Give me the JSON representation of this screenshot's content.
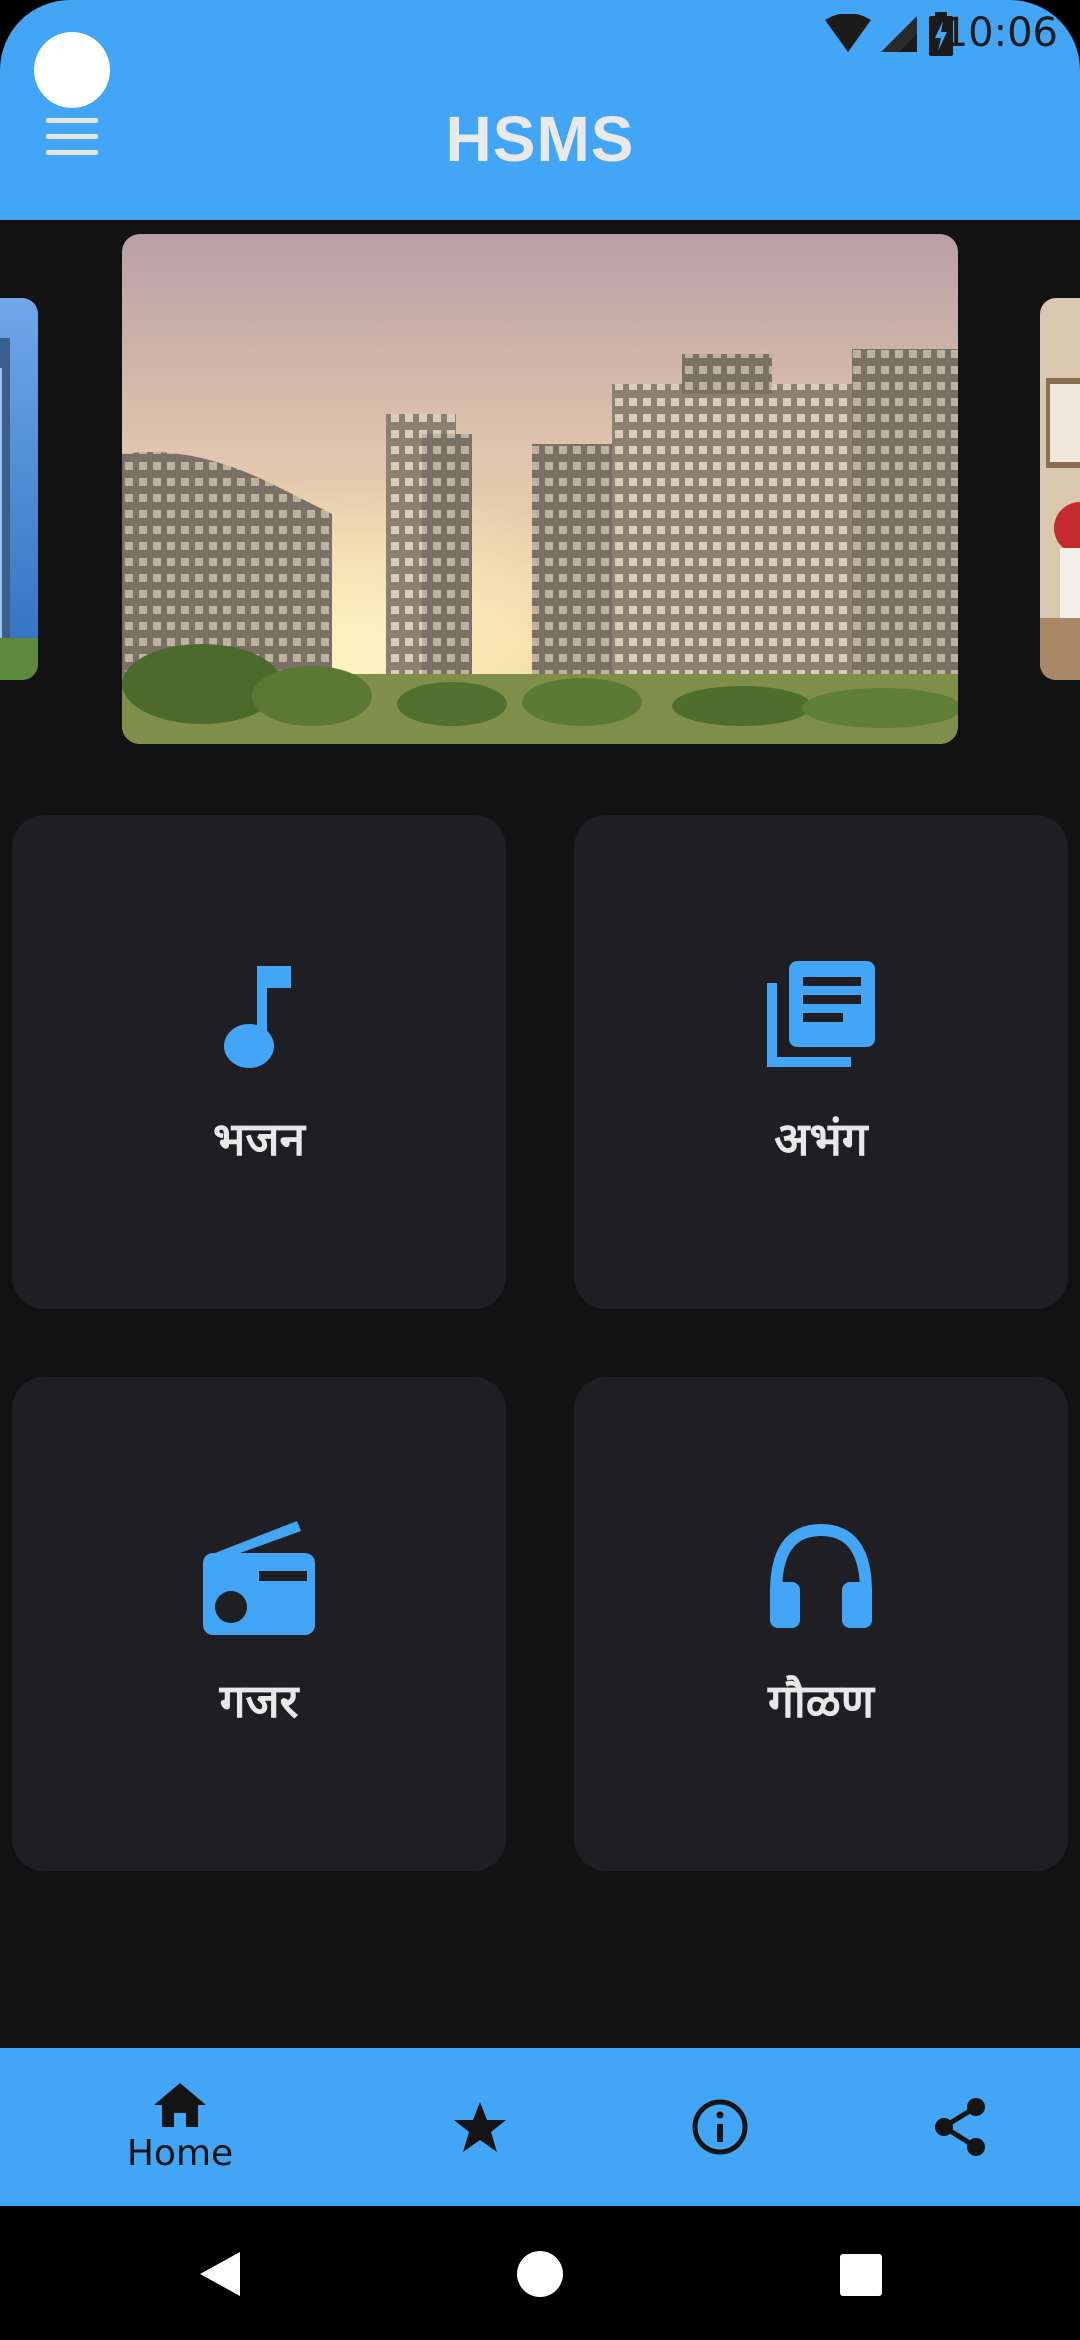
{
  "status_bar": {
    "time": "10:06",
    "icons": [
      "wifi-icon",
      "signal-icon",
      "battery-charging-icon"
    ]
  },
  "app_bar": {
    "title": "HSMS",
    "menu_icon": "hamburger-menu-icon",
    "color": "#42a5f5"
  },
  "carousel": {
    "slides": [
      "city-buildings-image",
      "sunset-towers-image",
      "interior-image"
    ],
    "active_index": 1
  },
  "categories": [
    {
      "label": "भजन",
      "icon": "music-note-icon"
    },
    {
      "label": "अभंग",
      "icon": "library-books-icon"
    },
    {
      "label": "गजर",
      "icon": "radio-icon"
    },
    {
      "label": "गौळण",
      "icon": "headphones-icon"
    }
  ],
  "bottom_nav": {
    "items": [
      {
        "label": "Home",
        "icon": "home-icon",
        "active": true
      },
      {
        "label": "",
        "icon": "star-icon"
      },
      {
        "label": "",
        "icon": "info-icon"
      },
      {
        "label": "",
        "icon": "share-icon"
      }
    ]
  },
  "system_nav": [
    "back-icon",
    "home-circle-icon",
    "recents-icon"
  ],
  "colors": {
    "accent": "#42a5f5",
    "background": "#121212",
    "card": "#1f1e22",
    "card_text": "#e8e8e8"
  }
}
